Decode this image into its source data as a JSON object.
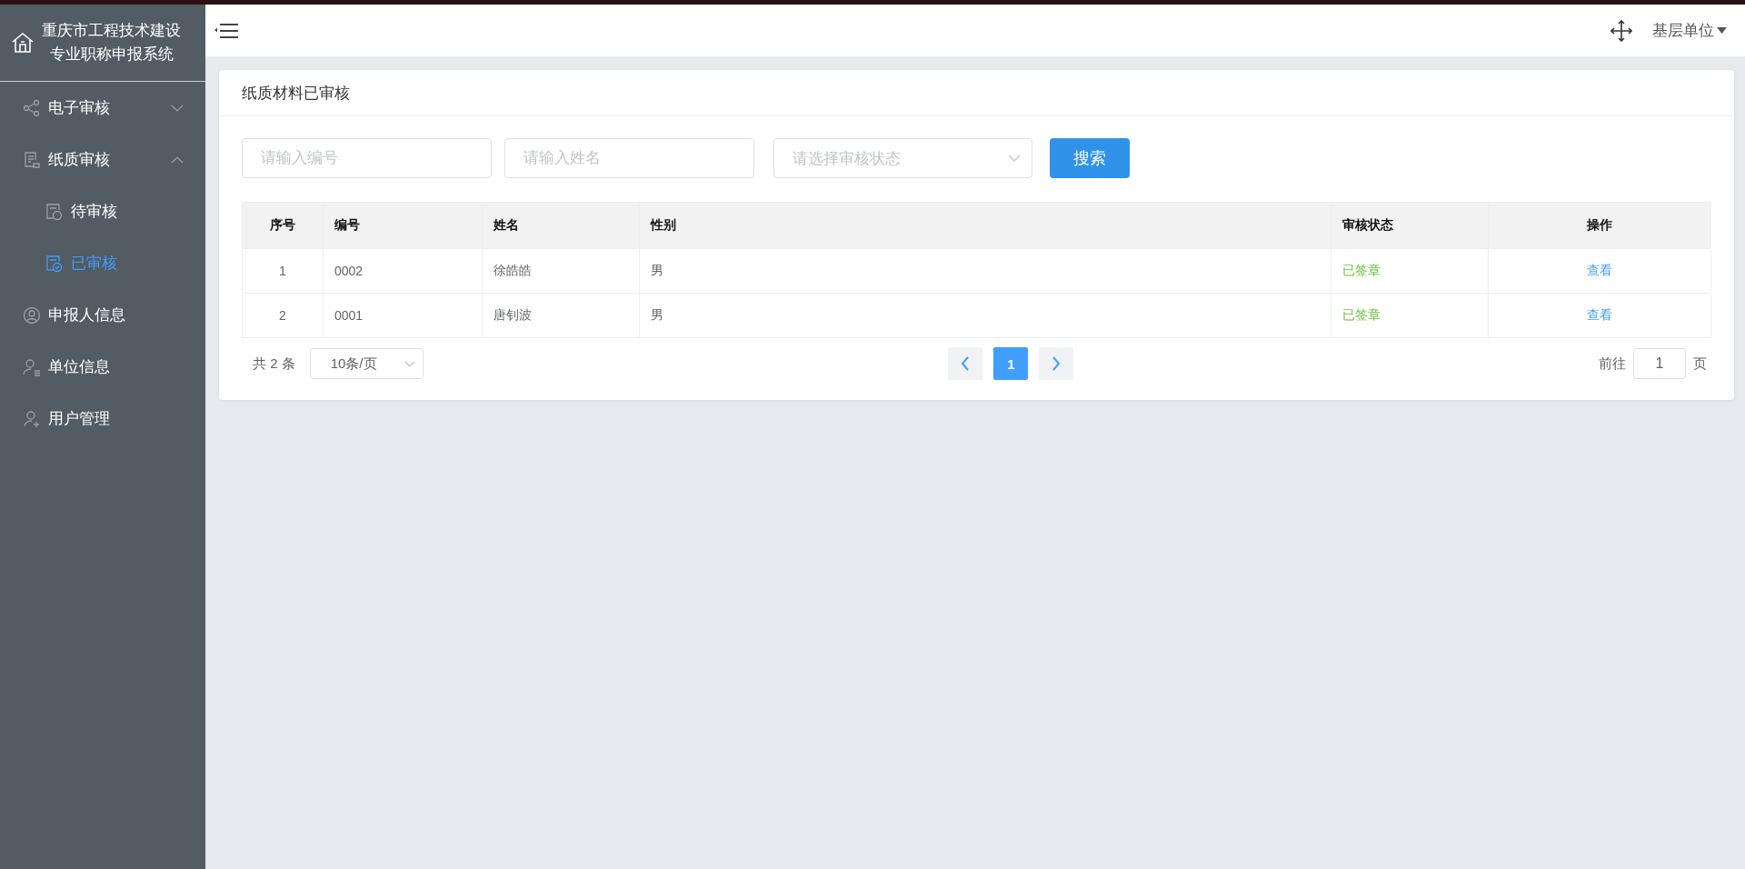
{
  "sidebar": {
    "title_lines": [
      "重庆市工程技术建设",
      "专业职称申报系统"
    ],
    "items": [
      {
        "label": "电子审核",
        "expanded": false,
        "selected": false
      },
      {
        "label": "纸质审核",
        "expanded": true,
        "selected": false,
        "children": [
          {
            "label": "待审核",
            "selected": false
          },
          {
            "label": "已审核",
            "selected": true
          }
        ]
      },
      {
        "label": "申报人信息",
        "selected": false
      },
      {
        "label": "单位信息",
        "selected": false
      },
      {
        "label": "用户管理",
        "selected": false
      }
    ]
  },
  "header": {
    "user": "基层单位"
  },
  "card": {
    "title": "纸质材料已审核"
  },
  "filters": {
    "number": {
      "placeholder": "请输入编号"
    },
    "name": {
      "placeholder": "请输入姓名"
    },
    "status": {
      "placeholder": "请选择审核状态"
    },
    "search_button": "搜索"
  },
  "table": {
    "columns": [
      "序号",
      "编号",
      "姓名",
      "性别",
      "审核状态",
      "操作"
    ],
    "rows": [
      {
        "index": "1",
        "number": "0002",
        "name": "徐皓皓",
        "gender": "男",
        "status": "已签章",
        "action": "查看"
      },
      {
        "index": "2",
        "number": "0001",
        "name": "唐钊波",
        "gender": "男",
        "status": "已签章",
        "action": "查看"
      }
    ]
  },
  "pagination": {
    "total": "共 2 条",
    "page_size": "10条/页",
    "pages": [
      {
        "label": "1",
        "selected": true
      }
    ],
    "goto_label": "前往",
    "goto_value": "1",
    "goto_suffix": "页"
  }
}
